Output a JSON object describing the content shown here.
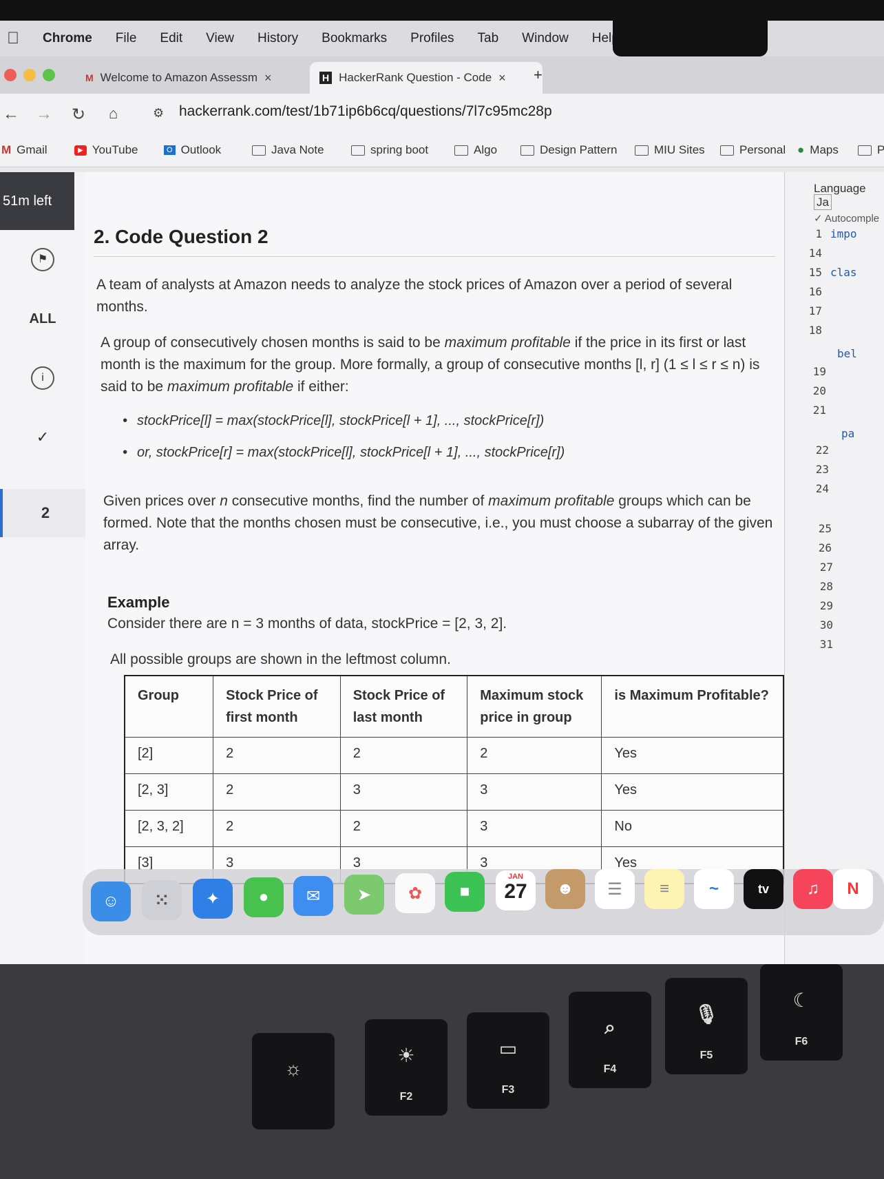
{
  "menubar": {
    "app": "Chrome",
    "items": [
      "File",
      "Edit",
      "View",
      "History",
      "Bookmarks",
      "Profiles",
      "Tab",
      "Window",
      "Help"
    ]
  },
  "tabs": [
    {
      "label": "Welcome to Amazon Assessm",
      "favicon": "M"
    },
    {
      "label": "HackerRank Question - Code",
      "favicon": "H"
    }
  ],
  "url": "hackerrank.com/test/1b71ip6b6cq/questions/7l7c95mc28p",
  "bookmarks": [
    "Gmail",
    "YouTube",
    "Outlook",
    "Java Note",
    "spring boot",
    "Algo",
    "Design Pattern",
    "MIU Sites",
    "Personal",
    "Maps",
    "P"
  ],
  "rail": {
    "timer": "51m left",
    "all": "ALL",
    "question_number": "2"
  },
  "question": {
    "title": "2. Code Question 2",
    "p1": "A team of analysts at Amazon needs to analyze the stock prices of Amazon over a period of several months.",
    "p2a": "A group of consecutively chosen months is said to be ",
    "p2em": "maximum profitable",
    "p2b": " if the price in its first or last month is the maximum for the group. More formally, a group of consecutive months [l, r] (1 ≤ l ≤ r ≤ n) is said to be ",
    "p2em2": "maximum profitable",
    "p2c": " if either:",
    "bullet1": "stockPrice[l] = max(stockPrice[l], stockPrice[l + 1], ..., stockPrice[r])",
    "bullet2": "or, stockPrice[r] = max(stockPrice[l], stockPrice[l + 1], ..., stockPrice[r])",
    "p3a": "Given prices over ",
    "p3n": "n",
    "p3b": " consecutive months, find the number of ",
    "p3em": "maximum profitable",
    "p3c": " groups which can be formed. Note that the months chosen must be consecutive, i.e., you must choose a subarray of the given array.",
    "example_title": "Example",
    "example_text": "Consider there are n = 3 months of data, stockPrice = [2, 3, 2].",
    "example_note": "All possible groups are shown in the leftmost column."
  },
  "table": {
    "headers": [
      "Group",
      "Stock Price of first month",
      "Stock Price of last month",
      "Maximum stock price in group",
      "is Maximum Profitable?"
    ],
    "rows": [
      [
        "[2]",
        "2",
        "2",
        "2",
        "Yes"
      ],
      [
        "[2, 3]",
        "2",
        "3",
        "3",
        "Yes"
      ],
      [
        "[2, 3, 2]",
        "2",
        "2",
        "3",
        "No"
      ],
      [
        "[3]",
        "3",
        "3",
        "3",
        "Yes"
      ]
    ]
  },
  "editor": {
    "language_label": "Language",
    "language_value": "Ja",
    "autocomplete": "Autocomple",
    "line_numbers": [
      "1",
      "14",
      "15",
      "16",
      "17",
      "18",
      "19",
      "20",
      "21",
      "22",
      "23",
      "24",
      "25",
      "26",
      "27",
      "28",
      "29",
      "30",
      "31"
    ],
    "code_snippets": [
      "impo",
      "clas",
      "bel",
      "pa"
    ]
  },
  "dock": {
    "calendar_month": "JAN",
    "calendar_day": "27",
    "tv_label": "tv"
  },
  "keyboard": {
    "keys": [
      "F2",
      "F3",
      "F4",
      "F5",
      "F6"
    ]
  }
}
